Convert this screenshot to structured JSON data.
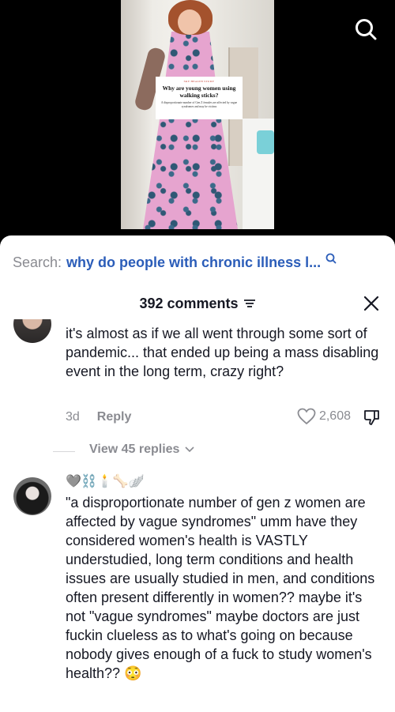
{
  "video": {
    "headline_card": {
      "kicker": "SKY HEALTH STUDY",
      "title": "Why are young women using walking sticks?",
      "body": "A disproportionate number of Gen Z females are affected by vague syndromes and may be victims"
    }
  },
  "search": {
    "prefix": "Search:",
    "query": "why do people with chronic illness l..."
  },
  "comments_header": {
    "count_label": "392 comments"
  },
  "comments": [
    {
      "text": "it's almost as if we all went through some sort of pandemic... that ended up being a mass disabling event in the long term, crazy right?",
      "time": "3d",
      "reply_label": "Reply",
      "likes": "2,608",
      "view_replies": "View 45 replies"
    },
    {
      "username_emojis": "🩶⛓️🕯️🦴🪽",
      "text": "\"a disproportionate number of gen z women are affected by vague syndromes\" umm have they considered women's health is VASTLY understudied, long term conditions and health issues are usually studied in men, and conditions often present differently in women?? maybe it's not \"vague syndromes\" maybe doctors are just fuckin clueless as to what's going on because nobody gives enough of a fuck to study women's health?? 😳"
    }
  ],
  "colors": {
    "accent_link": "#2b5db9",
    "muted": "#8a8b91",
    "text": "#161823"
  }
}
